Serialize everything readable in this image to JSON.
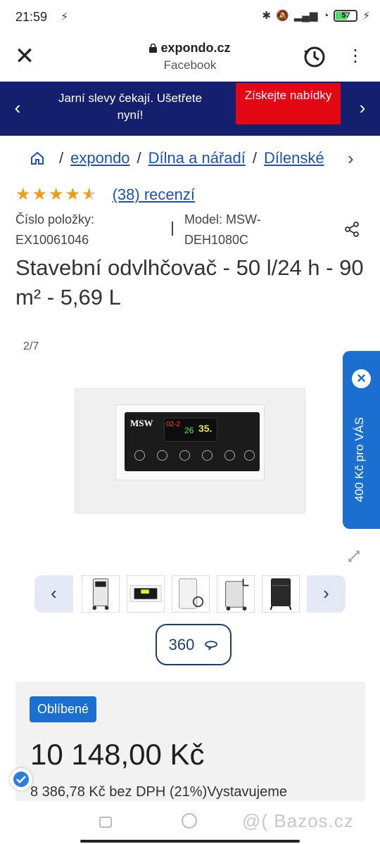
{
  "status_bar": {
    "time": "21:59",
    "battery": "57"
  },
  "browser": {
    "domain": "expondo.cz",
    "source": "Facebook"
  },
  "promo_banner": {
    "text": "Jarní slevy čekají. Ušetřete nyní!",
    "button_label": "Získejte nabídky"
  },
  "breadcrumb": {
    "items": [
      "expondo",
      "Dílna a nářadí",
      "Dílenské"
    ]
  },
  "rating": {
    "stars": 4.5,
    "reviews_label": "(38) recenzí"
  },
  "meta": {
    "item_number_label": "Číslo položky:",
    "item_number": "EX10061046",
    "model_label": "Model: MSW-",
    "model_value": "DEH1080C"
  },
  "product": {
    "title": "Stavební odvlhčovač - 50 l/24 h - 90 m² - 5,69 L"
  },
  "gallery": {
    "counter": "2/7",
    "side_promo": "400 Kč pro VÁS",
    "view_360": "360"
  },
  "panel_display": {
    "logo": "MSW",
    "left_readout": "02-2",
    "center_readout": "26",
    "right_readout": "35."
  },
  "price_card": {
    "badge": "Oblíbené",
    "price": "10 148,00 Kč",
    "price_sub": "8 386,78 Kč bez DPH (21%)Vystavujeme"
  },
  "watermark": "@( Bazos.cz",
  "colors": {
    "banner_bg": "#14206e",
    "cta_red": "#e30613",
    "link_blue": "#1a52b5",
    "star_orange": "#f39c12",
    "badge_blue": "#1a6fd1"
  }
}
